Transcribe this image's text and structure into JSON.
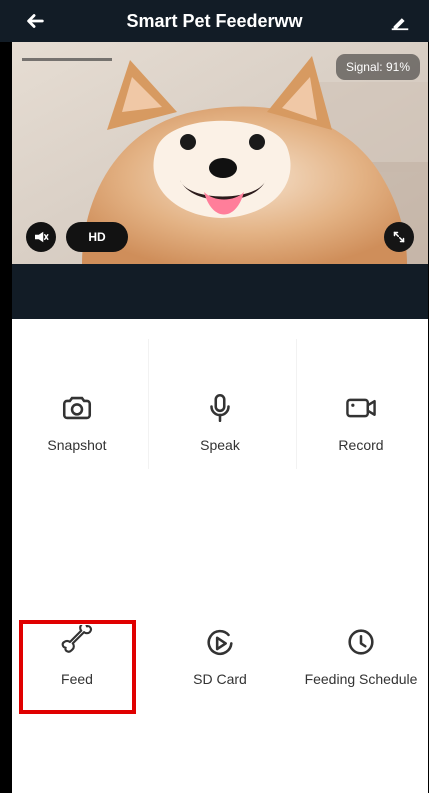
{
  "header": {
    "title": "Smart Pet Feederww",
    "back_icon": "back-arrow-icon",
    "edit_icon": "edit-pen-icon"
  },
  "camera": {
    "signal_text": "Signal: 91%",
    "hd_label": "HD",
    "mute_icon": "speaker-muted-icon",
    "fullscreen_icon": "fullscreen-icon"
  },
  "actions": {
    "row1": [
      {
        "label": "Snapshot",
        "icon": "camera-icon"
      },
      {
        "label": "Speak",
        "icon": "microphone-icon"
      },
      {
        "label": "Record",
        "icon": "video-record-icon"
      }
    ],
    "row2": [
      {
        "label": "Feed",
        "icon": "bone-icon"
      },
      {
        "label": "SD Card",
        "icon": "sd-card-play-icon"
      },
      {
        "label": "Feeding Schedule",
        "icon": "clock-icon"
      }
    ]
  },
  "colors": {
    "header_bg": "#121c26",
    "highlight_red": "#e00000",
    "panel_bg": "#ffffff"
  }
}
